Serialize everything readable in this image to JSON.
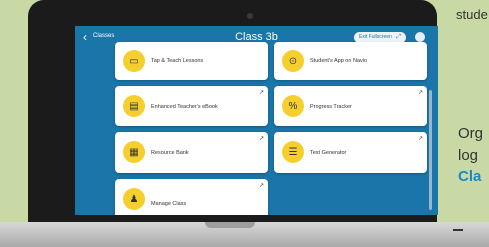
{
  "background": {
    "text_top": "stude",
    "text_line1": "Org",
    "text_line2": "log",
    "text_line3": "Cla"
  },
  "app": {
    "back_label": "Classes",
    "title": "Class 3b",
    "exit_label": "Exit Fullscreen",
    "user_icon": "user-icon"
  },
  "tiles": [
    {
      "label": "Tap & Teach Lessons",
      "icon": "presentation-icon"
    },
    {
      "label": "Student's App on Navio",
      "icon": "student-app-icon"
    },
    {
      "label": "Enhanced Teacher's eBook",
      "icon": "ebook-icon"
    },
    {
      "label": "Progress Tracker",
      "icon": "percent-icon"
    },
    {
      "label": "Resource Bank",
      "icon": "resource-icon"
    },
    {
      "label": "Test Generator",
      "icon": "test-generator-icon"
    },
    {
      "label": "Manage Class",
      "icon": "manage-class-icon"
    }
  ],
  "colors": {
    "app_blue": "#1a75a8",
    "tile_icon_yellow": "#f5cf2e",
    "accent_blue_text": "#1e88c8"
  }
}
